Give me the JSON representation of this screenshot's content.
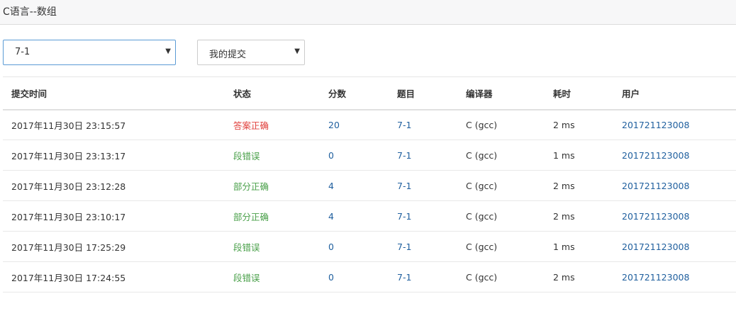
{
  "header": {
    "title": "C语言--数组"
  },
  "filters": {
    "problem_select": {
      "value": "7-1"
    },
    "scope_select": {
      "value": "我的提交"
    }
  },
  "colors": {
    "status_accepted": "#e0403c",
    "status_other": "#4aa04a",
    "link": "#1f5f9e",
    "select_focus_border": "#5b9bd5"
  },
  "table": {
    "columns": [
      "提交时间",
      "状态",
      "分数",
      "题目",
      "编译器",
      "耗时",
      "用户"
    ],
    "rows": [
      {
        "time": "2017年11月30日 23:15:57",
        "status": "答案正确",
        "score": "20",
        "problem": "7-1",
        "compiler": "C (gcc)",
        "elapsed": "2 ms",
        "user": "201721123008"
      },
      {
        "time": "2017年11月30日 23:13:17",
        "status": "段错误",
        "score": "0",
        "problem": "7-1",
        "compiler": "C (gcc)",
        "elapsed": "1 ms",
        "user": "201721123008"
      },
      {
        "time": "2017年11月30日 23:12:28",
        "status": "部分正确",
        "score": "4",
        "problem": "7-1",
        "compiler": "C (gcc)",
        "elapsed": "2 ms",
        "user": "201721123008"
      },
      {
        "time": "2017年11月30日 23:10:17",
        "status": "部分正确",
        "score": "4",
        "problem": "7-1",
        "compiler": "C (gcc)",
        "elapsed": "2 ms",
        "user": "201721123008"
      },
      {
        "time": "2017年11月30日 17:25:29",
        "status": "段错误",
        "score": "0",
        "problem": "7-1",
        "compiler": "C (gcc)",
        "elapsed": "1 ms",
        "user": "201721123008"
      },
      {
        "time": "2017年11月30日 17:24:55",
        "status": "段错误",
        "score": "0",
        "problem": "7-1",
        "compiler": "C (gcc)",
        "elapsed": "2 ms",
        "user": "201721123008"
      }
    ]
  }
}
